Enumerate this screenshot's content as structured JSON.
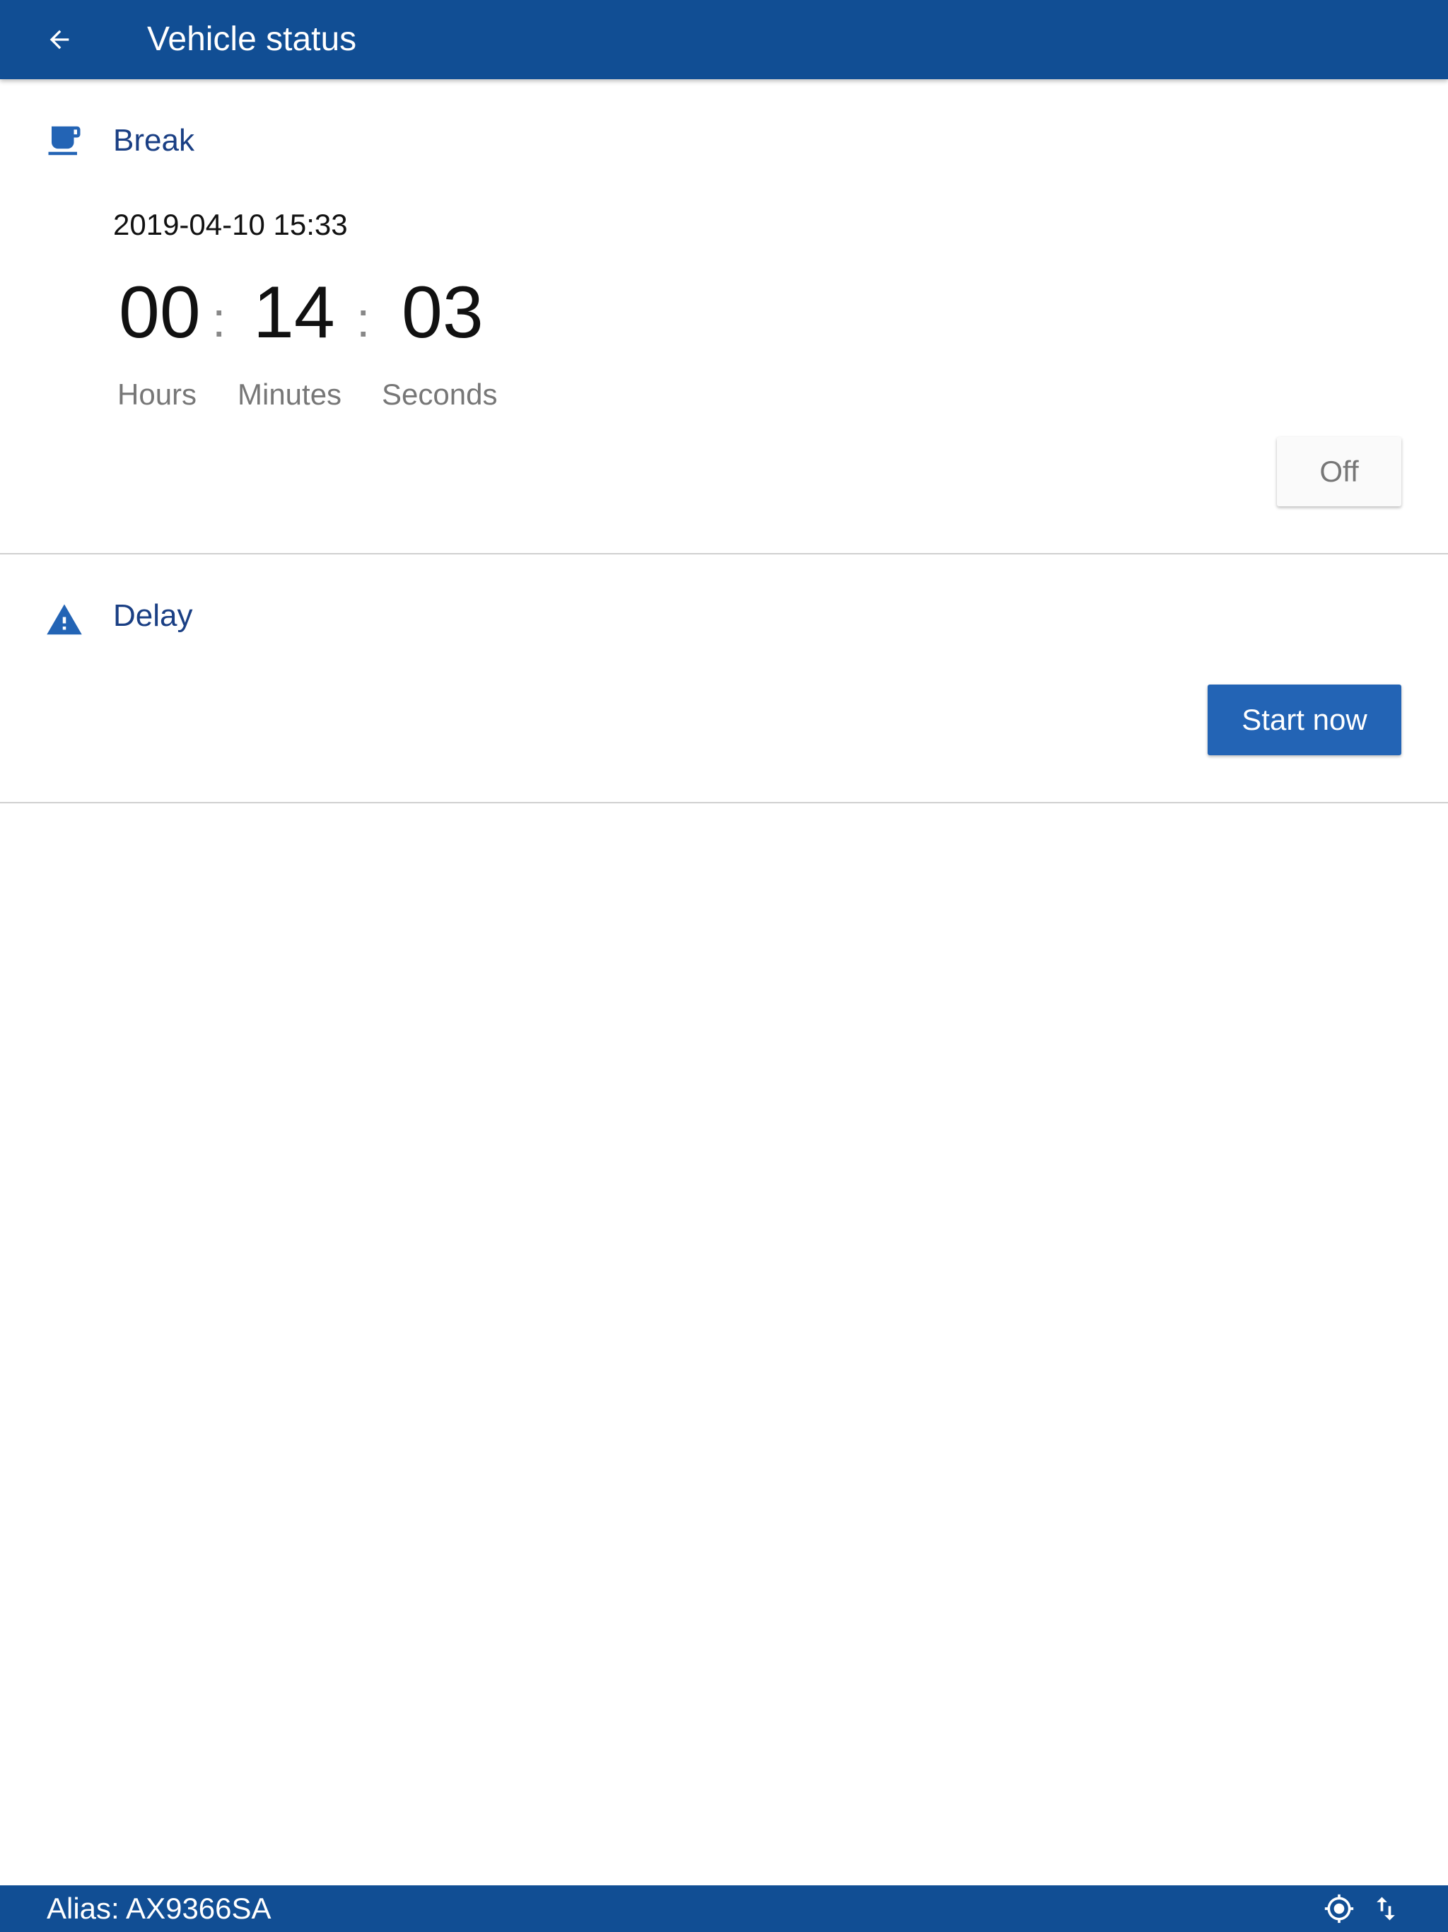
{
  "header": {
    "title": "Vehicle status",
    "back_icon": "arrow-back-icon"
  },
  "break_section": {
    "icon": "coffee-cup-icon",
    "title": "Break",
    "date": "2019-04-10 15:33",
    "timer": {
      "hours": "00",
      "minutes": "14",
      "seconds": "03",
      "separator": ":",
      "hours_label": "Hours",
      "minutes_label": "Minutes",
      "seconds_label": "Seconds"
    },
    "toggle_label": "Off"
  },
  "delay_section": {
    "icon": "warning-triangle-icon",
    "title": "Delay",
    "action_label": "Start now"
  },
  "status_bar": {
    "alias": "Alias: AX9366SA",
    "icons": [
      "gps-fixed-icon",
      "sync-arrows-icon"
    ]
  },
  "colors": {
    "primary": "#114e94",
    "accent": "#2364b5",
    "section_title": "#1a3f84"
  }
}
